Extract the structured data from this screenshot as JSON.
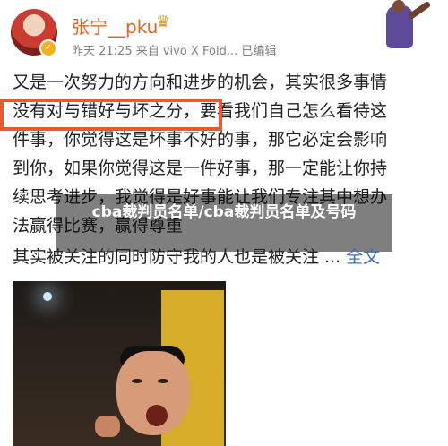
{
  "author": {
    "name": "张宁__pku",
    "meta": "昨天 21:25  来自 vivo X Fold...  已编辑",
    "badge_icon": "verified-icon",
    "crown_icon": "crown-icon"
  },
  "post": {
    "lines": [
      "又是一次努力的方向和进步的机会，其实很多事情",
      "没有对与错好与坏之分，要看我们自己怎么看待这",
      "件事，你觉得这是坏事不好的事，那它必定会影响",
      "到你，如果你觉得这是一件好事，那一定能让你持",
      "续思考进步，我觉得是好事能让我们专注其中想办",
      "法赢得比赛，赢得尊重"
    ],
    "last_line": "其实被关注的同时防守我的人也是被关注 ...",
    "full_text_link": "全文"
  },
  "overlay": {
    "text": "cba裁判员名单/cba裁判员名单及号码"
  },
  "colors": {
    "username": "#e06424",
    "highlight": "#e85a31",
    "link": "#3b6fb6"
  }
}
